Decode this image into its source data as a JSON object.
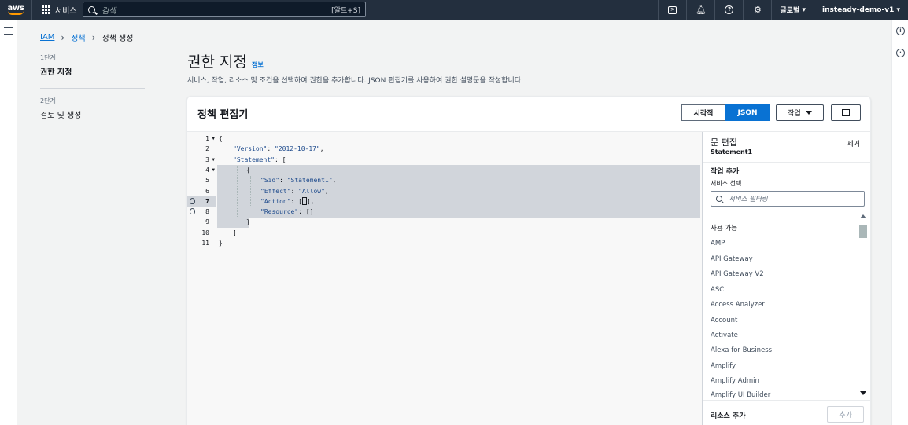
{
  "topnav": {
    "logo": "aws",
    "services_label": "서비스",
    "search_placeholder": "검색",
    "search_shortcut": "[알트+S]",
    "region_label": "글로벌",
    "account_label": "insteady-demo-v1",
    "icons": [
      "cloudshell-icon",
      "bell-icon",
      "help-icon",
      "gear-icon"
    ]
  },
  "breadcrumb": {
    "items": [
      "IAM",
      "정책",
      "정책 생성"
    ]
  },
  "steps": [
    {
      "small": "1단계",
      "title": "권한 지정"
    },
    {
      "small": "2단계",
      "title": "검토 및 생성"
    }
  ],
  "page": {
    "title": "권한 지정",
    "info_link": "정보",
    "description": "서비스, 작업, 리소스 및 조건을 선택하여 권한을 추가합니다. JSON 편집기를 사용하여 권한 설명문을 작성합니다."
  },
  "editor": {
    "title": "정책 편집기",
    "mode_visual": "시각적",
    "mode_json": "JSON",
    "actions_label": "작업",
    "active_line": 7,
    "lines": [
      "1",
      "2",
      "3",
      "4",
      "5",
      "6",
      "7",
      "8",
      "9",
      "10",
      "11"
    ],
    "code": {
      "l1": "{",
      "l2a": "\"Version\"",
      "l2b": ": ",
      "l2c": "\"2012-10-17\"",
      "l2d": ",",
      "l3a": "\"Statement\"",
      "l3b": ": [",
      "l4": "{",
      "l5a": "\"Sid\"",
      "l5b": ": ",
      "l5c": "\"Statement1\"",
      "l5d": ",",
      "l6a": "\"Effect\"",
      "l6b": ": ",
      "l6c": "\"Allow\"",
      "l6d": ",",
      "l7a": "\"Action\"",
      "l7b": ": [",
      "l7c": "],",
      "l8a": "\"Resource\"",
      "l8b": ": []",
      "l9": "}",
      "l10": "]",
      "l11": "}"
    }
  },
  "statement_panel": {
    "title": "문 편집",
    "statement_name": "Statement1",
    "remove_label": "제거",
    "add_actions_heading": "작업 추가",
    "choose_service_label": "서비스 선택",
    "filter_placeholder": "서비스 필터링",
    "available_group": "사용 가능",
    "services": [
      "AMP",
      "API Gateway",
      "API Gateway V2",
      "ASC",
      "Access Analyzer",
      "Account",
      "Activate",
      "Alexa for Business",
      "Amplify",
      "Amplify Admin",
      "Amplify UI Builder"
    ],
    "add_resource_heading": "리소스 추가",
    "add_button": "추가"
  },
  "colors": {
    "nav_bg": "#232f3e",
    "accent": "#0972d3",
    "logo_smile": "#ff9900",
    "selection": "#d1d5db"
  }
}
